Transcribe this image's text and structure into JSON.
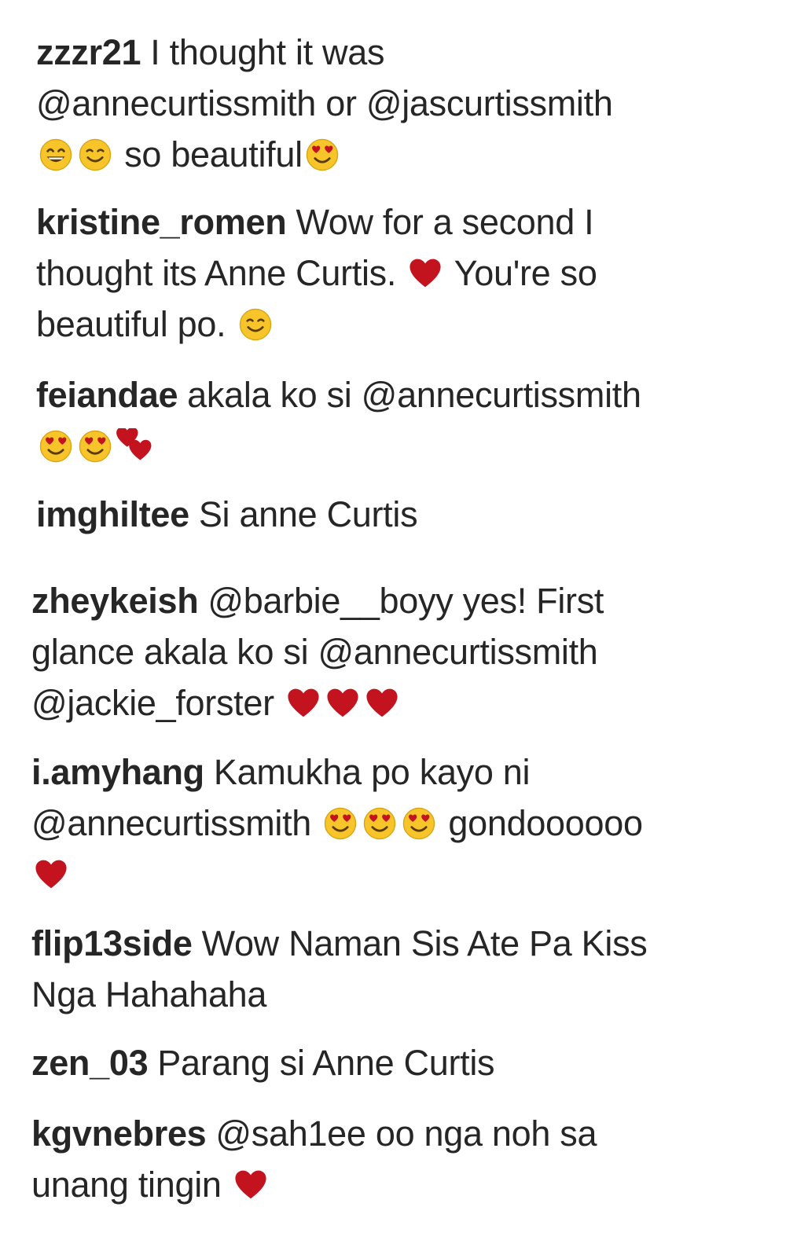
{
  "colors": {
    "text": "#262626",
    "background": "#ffffff",
    "heart": "#c3131f",
    "emoji_face": "#f7c529"
  },
  "comments": [
    {
      "username": "zzzr21",
      "parts": [
        {
          "t": "text",
          "v": "I thought it was"
        },
        {
          "t": "br"
        },
        {
          "t": "text",
          "v": "@annecurtissmith or @jascurtissmith"
        },
        {
          "t": "br"
        },
        {
          "t": "emoji",
          "name": "grinning-face-icon"
        },
        {
          "t": "emoji",
          "name": "smiling-face-icon"
        },
        {
          "t": "text",
          "v": " so beautiful"
        },
        {
          "t": "emoji",
          "name": "heart-eyes-face-icon"
        }
      ]
    },
    {
      "username": "kristine_romen",
      "parts": [
        {
          "t": "text",
          "v": "Wow for a second I"
        },
        {
          "t": "br"
        },
        {
          "t": "text",
          "v": "thought its Anne Curtis. "
        },
        {
          "t": "emoji",
          "name": "heart-icon"
        },
        {
          "t": "text",
          "v": " You're so"
        },
        {
          "t": "br"
        },
        {
          "t": "text",
          "v": "beautiful po. "
        },
        {
          "t": "emoji",
          "name": "smiling-face-icon"
        }
      ]
    },
    {
      "username": "feiandae",
      "parts": [
        {
          "t": "text",
          "v": "akala ko si @annecurtissmith"
        },
        {
          "t": "br"
        },
        {
          "t": "emoji",
          "name": "heart-eyes-face-icon"
        },
        {
          "t": "emoji",
          "name": "heart-eyes-face-icon"
        },
        {
          "t": "emoji",
          "name": "two-hearts-icon"
        }
      ]
    },
    {
      "username": "imghiltee",
      "parts": [
        {
          "t": "text",
          "v": "Si anne Curtis"
        }
      ]
    },
    {
      "username": "zheykeish",
      "parts": [
        {
          "t": "text",
          "v": "@barbie__boyy yes! First"
        },
        {
          "t": "br"
        },
        {
          "t": "text",
          "v": "glance akala ko si @annecurtissmith"
        },
        {
          "t": "br"
        },
        {
          "t": "text",
          "v": "@jackie_forster "
        },
        {
          "t": "emoji",
          "name": "heart-icon"
        },
        {
          "t": "emoji",
          "name": "heart-icon"
        },
        {
          "t": "emoji",
          "name": "heart-icon"
        }
      ]
    },
    {
      "username": "i.amyhang",
      "parts": [
        {
          "t": "text",
          "v": "Kamukha po kayo ni"
        },
        {
          "t": "br"
        },
        {
          "t": "text",
          "v": "@annecurtissmith "
        },
        {
          "t": "emoji",
          "name": "heart-eyes-face-icon"
        },
        {
          "t": "emoji",
          "name": "heart-eyes-face-icon"
        },
        {
          "t": "emoji",
          "name": "heart-eyes-face-icon"
        },
        {
          "t": "text",
          "v": " gondoooooo"
        },
        {
          "t": "br"
        },
        {
          "t": "emoji",
          "name": "heart-icon"
        }
      ]
    },
    {
      "username": "flip13side",
      "parts": [
        {
          "t": "text",
          "v": "Wow Naman Sis Ate Pa Kiss"
        },
        {
          "t": "br"
        },
        {
          "t": "text",
          "v": "Nga Hahahaha"
        }
      ]
    },
    {
      "username": "zen_03",
      "parts": [
        {
          "t": "text",
          "v": "Parang si Anne Curtis"
        }
      ]
    },
    {
      "username": "kgvnebres",
      "parts": [
        {
          "t": "text",
          "v": "@sah1ee oo nga noh sa"
        },
        {
          "t": "br"
        },
        {
          "t": "text",
          "v": "unang tingin "
        },
        {
          "t": "emoji",
          "name": "heart-icon"
        }
      ]
    }
  ]
}
